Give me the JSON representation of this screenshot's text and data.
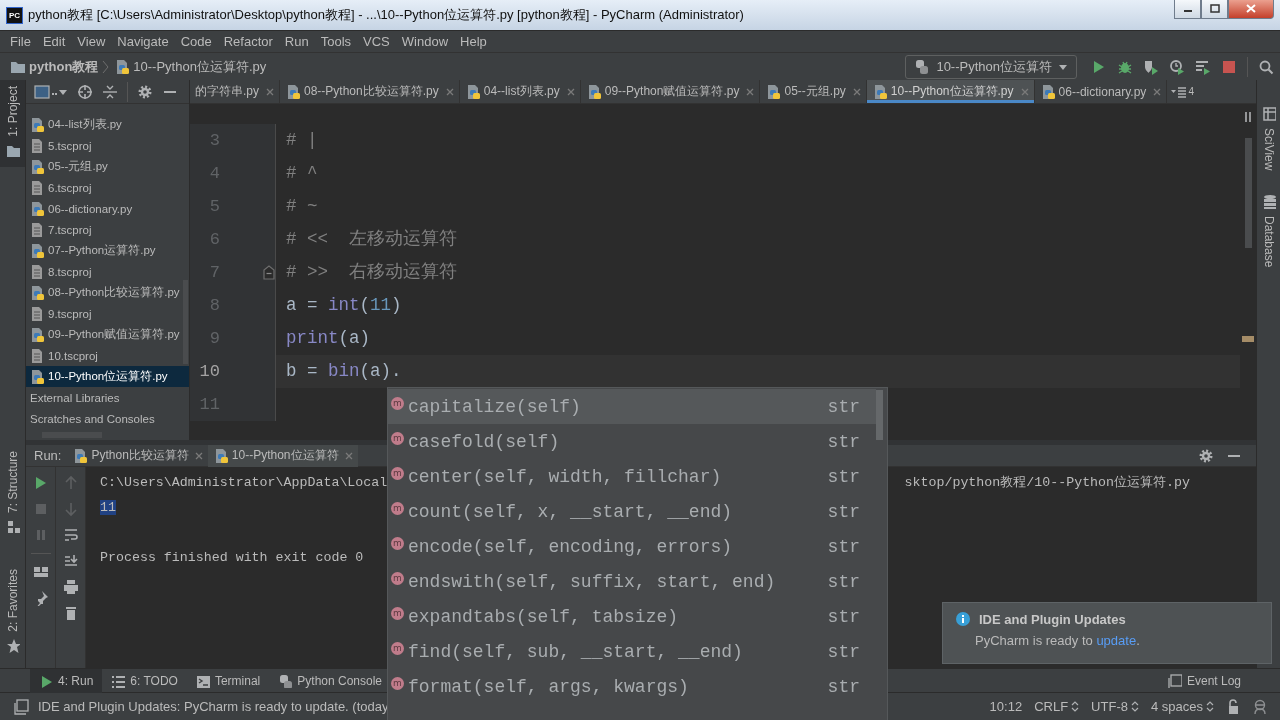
{
  "window": {
    "logo": "PC",
    "title": "python教程 [C:\\Users\\Administrator\\Desktop\\python教程] - ...\\10--Python位运算符.py [python教程] - PyCharm (Administrator)"
  },
  "menu": [
    "File",
    "Edit",
    "View",
    "Navigate",
    "Code",
    "Refactor",
    "Run",
    "Tools",
    "VCS",
    "Window",
    "Help"
  ],
  "breadcrumb": [
    {
      "label": "python教程",
      "kind": "folder"
    },
    {
      "label": "10--Python位运算符.py",
      "kind": "python"
    }
  ],
  "run_config": {
    "label": "10--Python位运算符"
  },
  "left_stripe": [
    {
      "label": "1: Project",
      "kind": "project",
      "selected": true
    },
    {
      "label": "7: Structure",
      "kind": "structure",
      "selected": false
    },
    {
      "label": "2: Favorites",
      "kind": "favorites",
      "selected": false
    }
  ],
  "right_stripe": [
    {
      "label": "SciView",
      "kind": "sciview"
    },
    {
      "label": "Database",
      "kind": "database"
    }
  ],
  "project_tree": [
    {
      "label": "04--list列表.py",
      "kind": "python",
      "selected": false
    },
    {
      "label": "5.tscproj",
      "kind": "file",
      "selected": false
    },
    {
      "label": "05--元组.py",
      "kind": "python",
      "selected": false
    },
    {
      "label": "6.tscproj",
      "kind": "file",
      "selected": false
    },
    {
      "label": "06--dictionary.py",
      "kind": "python",
      "selected": false
    },
    {
      "label": "7.tscproj",
      "kind": "file",
      "selected": false
    },
    {
      "label": "07--Python运算符.py",
      "kind": "python",
      "selected": false
    },
    {
      "label": "8.tscproj",
      "kind": "file",
      "selected": false
    },
    {
      "label": "08--Python比较运算符.py",
      "kind": "python",
      "selected": false
    },
    {
      "label": "9.tscproj",
      "kind": "file",
      "selected": false
    },
    {
      "label": "09--Python赋值运算符.py",
      "kind": "python",
      "selected": false
    },
    {
      "label": "10.tscproj",
      "kind": "file",
      "selected": false
    },
    {
      "label": "10--Python位运算符.py",
      "kind": "python",
      "selected": true
    },
    {
      "label": "External Libraries",
      "kind": "group",
      "selected": false
    },
    {
      "label": "Scratches and Consoles",
      "kind": "group",
      "selected": false
    }
  ],
  "editor": {
    "tabs": [
      {
        "label": "的字符串.py",
        "kind": "partial",
        "selected": false
      },
      {
        "label": "08--Python比较运算符.py",
        "kind": "file",
        "selected": false
      },
      {
        "label": "04--list列表.py",
        "kind": "file",
        "selected": false
      },
      {
        "label": "09--Python赋值运算符.py",
        "kind": "file",
        "selected": false
      },
      {
        "label": "05--元组.py",
        "kind": "file",
        "selected": false
      },
      {
        "label": "10--Python位运算符.py",
        "kind": "file",
        "selected": true
      },
      {
        "label": "06--dictionary.py",
        "kind": "file",
        "selected": false
      }
    ],
    "hidden_tab_count": "4",
    "lines": [
      {
        "number": "3",
        "current": false,
        "tokens": [
          {
            "text": "# |",
            "kind": "comment"
          }
        ]
      },
      {
        "number": "4",
        "current": false,
        "tokens": [
          {
            "text": "# ^",
            "kind": "comment"
          }
        ]
      },
      {
        "number": "5",
        "current": false,
        "tokens": [
          {
            "text": "# ~",
            "kind": "comment"
          }
        ]
      },
      {
        "number": "6",
        "current": false,
        "tokens": [
          {
            "text": "# <<  左移动运算符",
            "kind": "comment"
          }
        ]
      },
      {
        "number": "7",
        "current": false,
        "fold": true,
        "tokens": [
          {
            "text": "# >>  右移动运算符",
            "kind": "comment"
          }
        ]
      },
      {
        "number": "8",
        "current": false,
        "tokens": [
          {
            "text": "a = ",
            "kind": "plain"
          },
          {
            "text": "int",
            "kind": "builtin"
          },
          {
            "text": "(",
            "kind": "plain"
          },
          {
            "text": "11",
            "kind": "number"
          },
          {
            "text": ")",
            "kind": "plain"
          }
        ]
      },
      {
        "number": "9",
        "current": false,
        "tokens": [
          {
            "text": "print",
            "kind": "builtin"
          },
          {
            "text": "(a)",
            "kind": "plain"
          }
        ]
      },
      {
        "number": "10",
        "current": true,
        "tokens": [
          {
            "text": "b = ",
            "kind": "plain"
          },
          {
            "text": "bin",
            "kind": "builtin"
          },
          {
            "text": "(a).",
            "kind": "plain"
          }
        ]
      },
      {
        "number": "11",
        "current": false
      }
    ]
  },
  "completion": [
    {
      "badge": "m",
      "signature": "capitalize(self)",
      "type": "str",
      "selected": true
    },
    {
      "badge": "m",
      "signature": "casefold(self)",
      "type": "str",
      "selected": false
    },
    {
      "badge": "m",
      "signature": "center(self, width, fillchar)",
      "type": "str",
      "selected": false
    },
    {
      "badge": "m",
      "signature": "count(self, x, __start, __end)",
      "type": "str",
      "selected": false
    },
    {
      "badge": "m",
      "signature": "encode(self, encoding, errors)",
      "type": "str",
      "selected": false
    },
    {
      "badge": "m",
      "signature": "endswith(self, suffix, start, end)",
      "type": "str",
      "selected": false
    },
    {
      "badge": "m",
      "signature": "expandtabs(self, tabsize)",
      "type": "str",
      "selected": false
    },
    {
      "badge": "m",
      "signature": "find(self, sub, __start, __end)",
      "type": "str",
      "selected": false
    },
    {
      "badge": "m",
      "signature": "format(self, args, kwargs)",
      "type": "str",
      "selected": false
    }
  ],
  "run_panel": {
    "label": "Run:",
    "tabs": [
      {
        "label": "Python比较运算符",
        "selected": false
      },
      {
        "label": "10--Python位运算符",
        "selected": true
      }
    ],
    "console": {
      "command_start": "C:\\Users\\Administrator\\AppData\\Local",
      "command_end": "sktop/python教程/10--Python位运算符.py",
      "output": "11",
      "output_selected": true,
      "exit_message": "Process finished with exit code 0"
    }
  },
  "tool_buttons": [
    {
      "label": "4: Run",
      "kind": "run",
      "selected": true
    },
    {
      "label": "6: TODO",
      "kind": "todo",
      "selected": false
    },
    {
      "label": "Terminal",
      "kind": "terminal",
      "selected": false
    },
    {
      "label": "Python Console",
      "kind": "python",
      "selected": false
    }
  ],
  "event_log": {
    "label": "Event Log"
  },
  "notification": {
    "title": "IDE and Plugin Updates",
    "message": "PyCharm is ready to ",
    "link": "update",
    "message_end": "."
  },
  "status_bar": {
    "message": "IDE and Plugin Updates: PyCharm is ready to update. (today",
    "items": [
      {
        "label": "10:12",
        "kind": "text"
      },
      {
        "label": "CRLF",
        "kind": "select"
      },
      {
        "label": "UTF-8",
        "kind": "select"
      },
      {
        "label": "4 spaces",
        "kind": "select"
      }
    ]
  }
}
